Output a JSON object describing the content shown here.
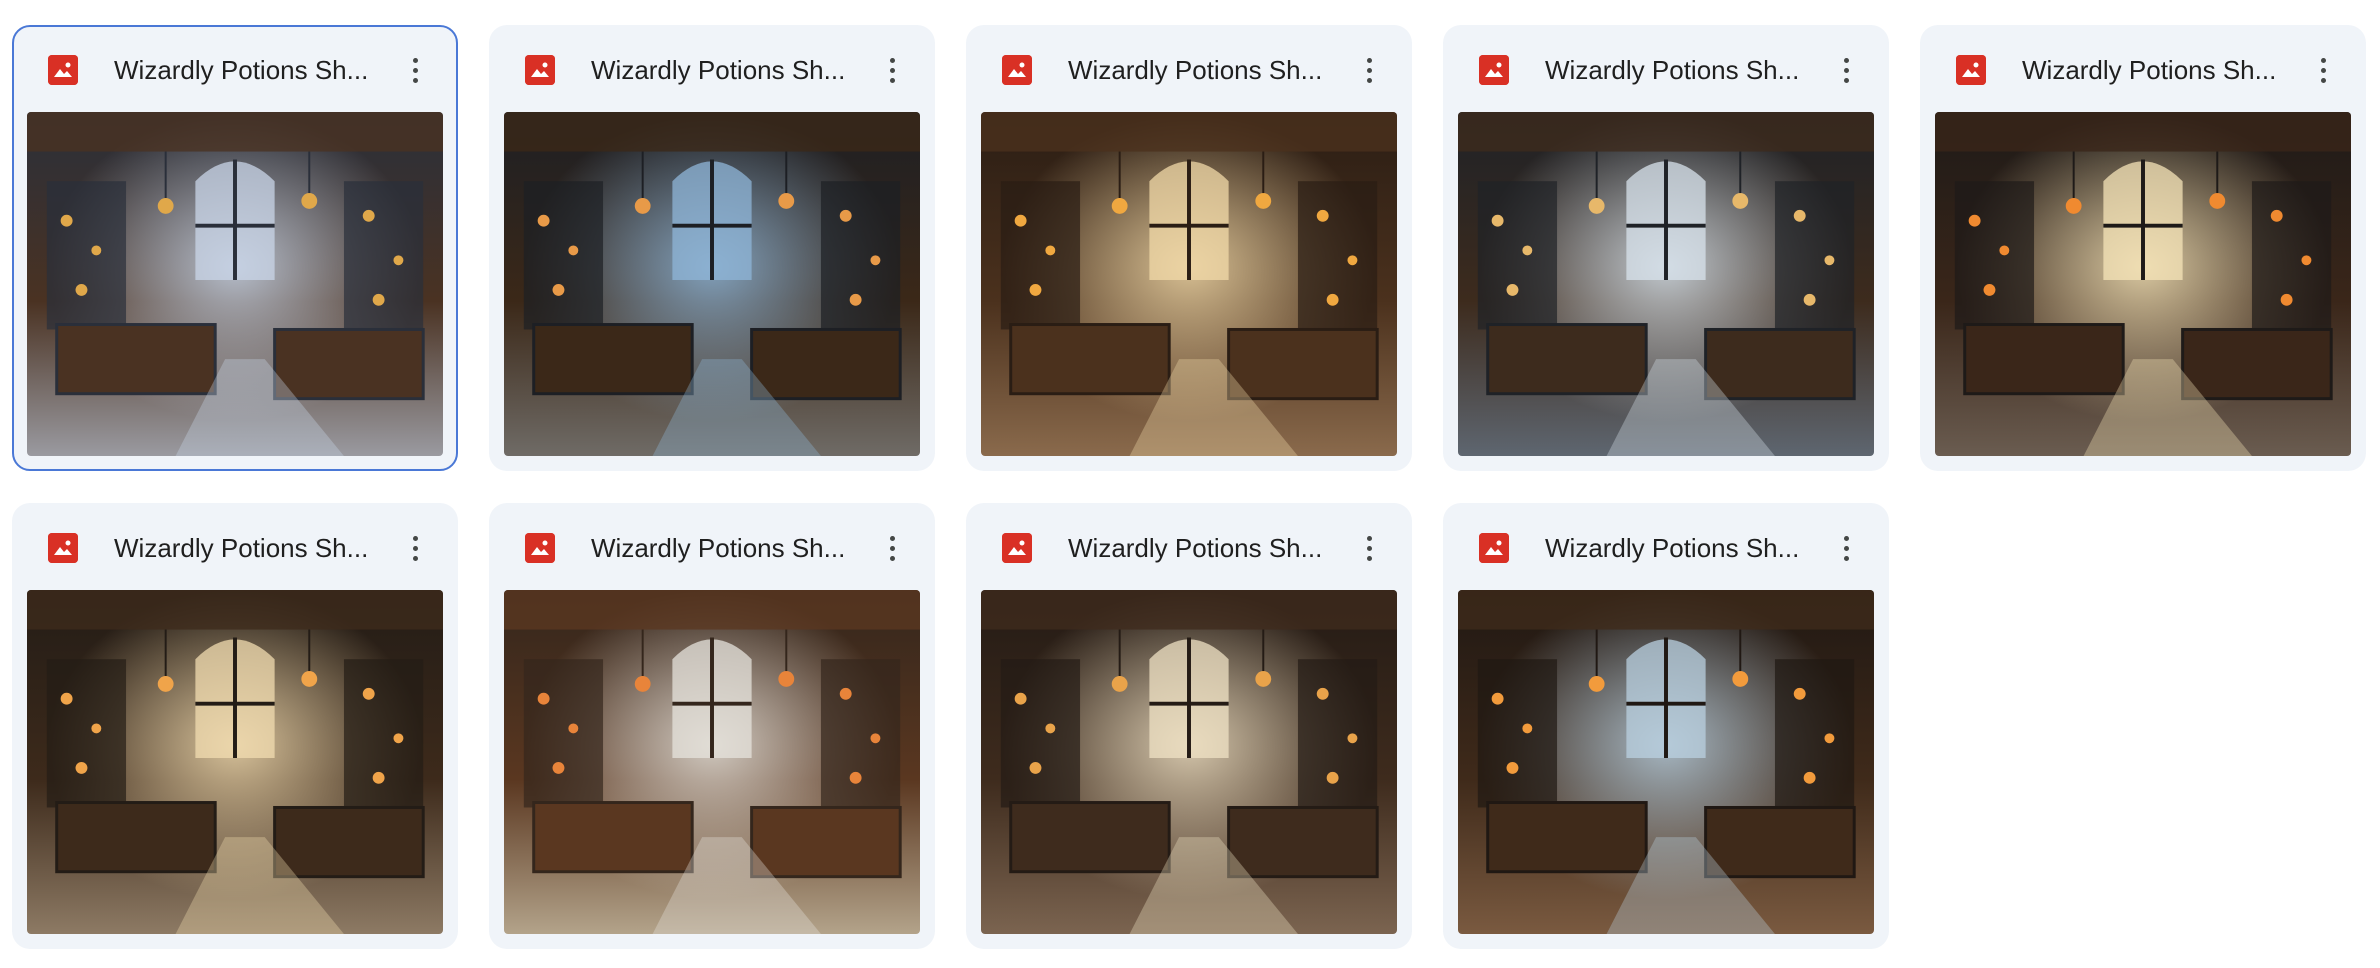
{
  "files": [
    {
      "title": "Wizardly Potions Sh...",
      "selected": true,
      "icon": "image-file-icon",
      "palette": {
        "bg": "#2a2f3a",
        "floor": "#9a9aa0",
        "light": "#c9d6e8",
        "wood": "#4a3222",
        "glow": "#e0a84a"
      }
    },
    {
      "title": "Wizardly Potions Sh...",
      "selected": false,
      "icon": "image-file-icon",
      "palette": {
        "bg": "#1d1f24",
        "floor": "#6f6b66",
        "light": "#8fb6d8",
        "wood": "#3b2818",
        "glow": "#e89a48"
      }
    },
    {
      "title": "Wizardly Potions Sh...",
      "selected": false,
      "icon": "image-file-icon",
      "palette": {
        "bg": "#2a1d14",
        "floor": "#8a6a4c",
        "light": "#f1d9a8",
        "wood": "#4b311d",
        "glow": "#f0a840"
      }
    },
    {
      "title": "Wizardly Potions Sh...",
      "selected": false,
      "icon": "image-file-icon",
      "palette": {
        "bg": "#1f2227",
        "floor": "#5e6670",
        "light": "#d8e3ec",
        "wood": "#3d2b1d",
        "glow": "#e7b86a"
      }
    },
    {
      "title": "Wizardly Potions Sh...",
      "selected": false,
      "icon": "image-file-icon",
      "palette": {
        "bg": "#1e1a18",
        "floor": "#6a5c50",
        "light": "#f5e4b8",
        "wood": "#3a2619",
        "glow": "#f08a30"
      }
    },
    {
      "title": "Wizardly Potions Sh...",
      "selected": false,
      "icon": "image-file-icon",
      "palette": {
        "bg": "#231c16",
        "floor": "#8d7a64",
        "light": "#f2dcb0",
        "wood": "#3d2a1b",
        "glow": "#f0a44a"
      }
    },
    {
      "title": "Wizardly Potions Sh...",
      "selected": false,
      "icon": "image-file-icon",
      "palette": {
        "bg": "#34261c",
        "floor": "#b3a38a",
        "light": "#e6e3dc",
        "wood": "#5a3720",
        "glow": "#e8843a"
      }
    },
    {
      "title": "Wizardly Potions Sh...",
      "selected": false,
      "icon": "image-file-icon",
      "palette": {
        "bg": "#241b15",
        "floor": "#7b6450",
        "light": "#efe1c4",
        "wood": "#3e2b1d",
        "glow": "#e9a34a"
      }
    },
    {
      "title": "Wizardly Potions Sh...",
      "selected": false,
      "icon": "image-file-icon",
      "palette": {
        "bg": "#201813",
        "floor": "#7a5a40",
        "light": "#b9d0e0",
        "wood": "#3f2a1a",
        "glow": "#f29b3c"
      }
    }
  ]
}
